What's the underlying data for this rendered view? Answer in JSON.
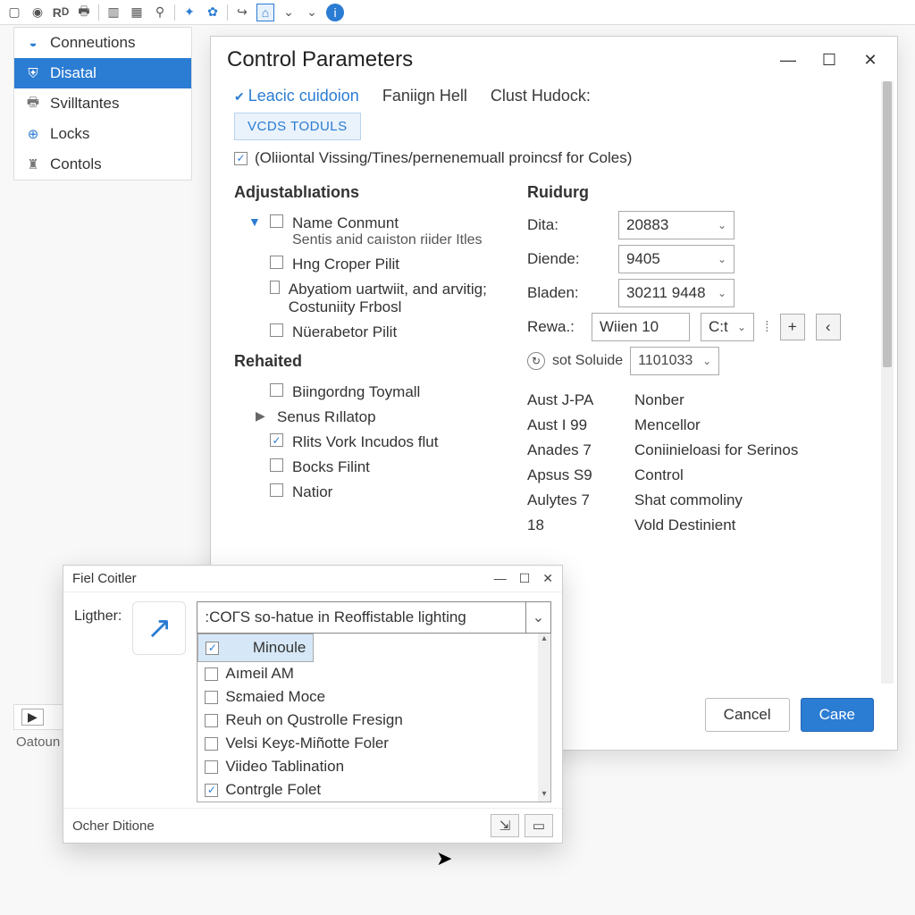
{
  "toolbar": {
    "icons": [
      "square",
      "globe",
      "rd",
      "printer",
      "panel-left",
      "panel-grid",
      "wand",
      "sparkle",
      "gear",
      "share",
      "home",
      "chev-down",
      "chev-down",
      "info"
    ]
  },
  "sidebar": {
    "items": [
      {
        "icon": "plug",
        "label": "Conneutions"
      },
      {
        "icon": "shield",
        "label": "Disatal"
      },
      {
        "icon": "printer",
        "label": "Svilltantes"
      },
      {
        "icon": "globe",
        "label": "Locks"
      },
      {
        "icon": "stamp",
        "label": "Contols"
      }
    ],
    "selected_index": 1
  },
  "dialog": {
    "title": "Control Parameters",
    "tabs": [
      {
        "label": "Leacic cuidoion",
        "active": true
      },
      {
        "label": "Faniign Hell",
        "active": false
      },
      {
        "label": "Clust Hudock:",
        "active": false
      }
    ],
    "vcds_button": "VCDS TODULS",
    "global_checkbox": {
      "checked": true,
      "label": "(Oliiontal Vissing/Tines/pernenemuall proincsf for Coles)"
    },
    "adjust": {
      "heading": "Adjustablıations",
      "items": [
        {
          "caret": "down",
          "checked": false,
          "label": "Name Conmunt",
          "sub": "Sentis anid caıiston riider Itles"
        },
        {
          "checked": false,
          "label": "Hng Croper Pilit"
        },
        {
          "checked": false,
          "label": "Abyatiom uartwiit, and arvitig; Costuniity Frbosl"
        },
        {
          "checked": false,
          "label": "Nüerabetor Pilit"
        }
      ]
    },
    "rehaited": {
      "heading": "Rehaited",
      "items": [
        {
          "checked": false,
          "label": "Biingordng Toymall"
        },
        {
          "caret": "right",
          "label": "Senus Rıllatop"
        },
        {
          "checked": true,
          "label": "Rlits Vork Incudos flut"
        },
        {
          "checked": false,
          "label": "Bocks Filint"
        },
        {
          "checked": false,
          "label": "Natior"
        }
      ]
    },
    "ruidurg": {
      "heading": "Ruidurg",
      "fields": {
        "dita": {
          "label": "Dita:",
          "value": "20883"
        },
        "diende": {
          "label": "Diende:",
          "value": "9405"
        },
        "bladen": {
          "label": "Bladen:",
          "value": "30211 9448"
        },
        "rewa": {
          "label": "Rewa.:",
          "value": "Wiien 10",
          "extra": "C:t"
        }
      },
      "status": {
        "icon": "refresh",
        "text": "sot Soluide",
        "num": "1101033"
      }
    },
    "kv": [
      {
        "k": "Aust J-PA",
        "v": "Nonber"
      },
      {
        "k": "Aust I 99",
        "v": "Mencellor"
      },
      {
        "k": "Anades 7",
        "v": "Coniinieloasi for Serinos"
      },
      {
        "k": "Apsus S9",
        "v": "Control"
      },
      {
        "k": "Aulytes 7",
        "v": "Shat commoliny"
      },
      {
        "k": "18",
        "v": "Vold Destinient"
      }
    ],
    "buttons": {
      "cancel": "Cancel",
      "ok": "Caʀe"
    }
  },
  "popup": {
    "title": "Fiel Coitler",
    "label": "Ligther:",
    "combo_value": ":COГS so-hatue in Reoffistable lighting",
    "options": [
      {
        "checked": true,
        "label": "Minoule",
        "sel": true
      },
      {
        "checked": false,
        "label": "Aımeil AM"
      },
      {
        "checked": false,
        "label": "Sɛmaied Moce"
      },
      {
        "checked": false,
        "label": "Reuh on Qustrolle Fresign"
      },
      {
        "checked": false,
        "label": "Velsi Keyɛ-Miñotte Foler"
      },
      {
        "checked": false,
        "label": "Viideo Tablination"
      },
      {
        "checked": true,
        "label": "Contrgle Folet"
      }
    ],
    "status_left": "Ocher Ditione"
  },
  "bottom": {
    "status": "Oatoun"
  }
}
